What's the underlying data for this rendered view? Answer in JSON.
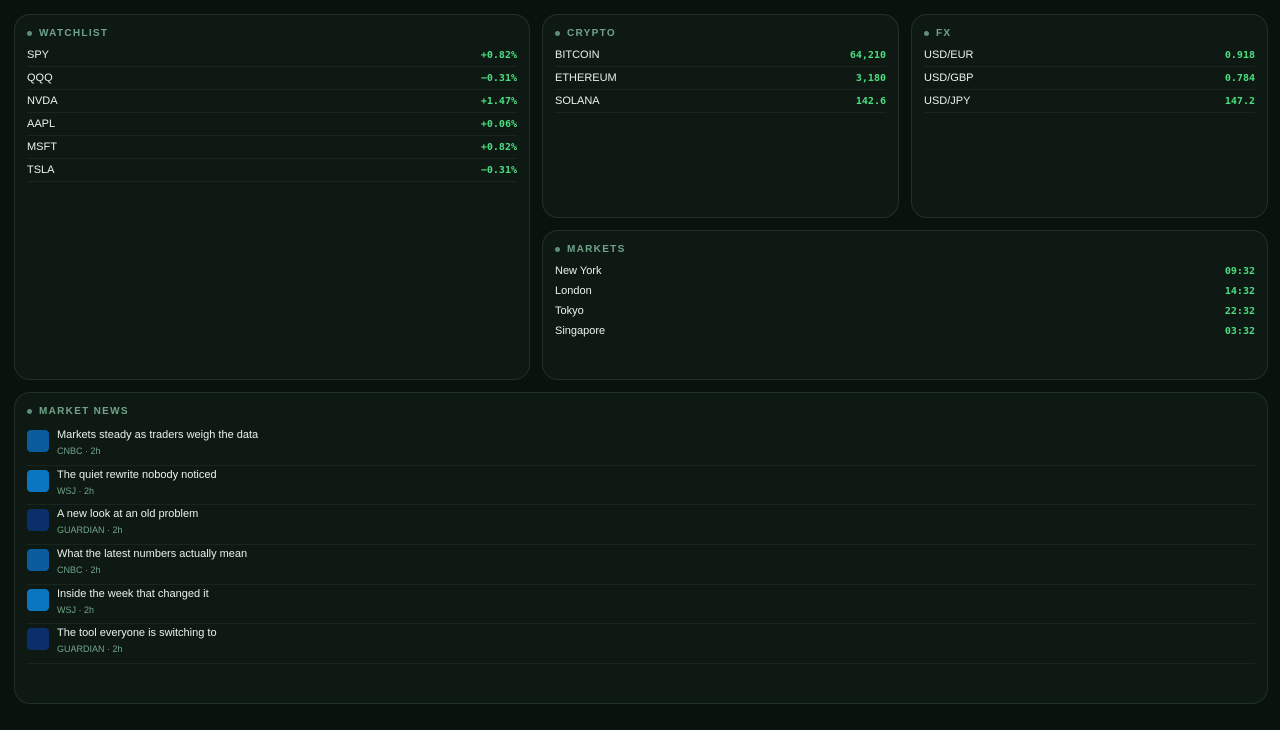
{
  "watchlist": {
    "title": "WATCHLIST",
    "items": [
      {
        "symbol": "SPY",
        "change": "+0.82%"
      },
      {
        "symbol": "QQQ",
        "change": "−0.31%"
      },
      {
        "symbol": "NVDA",
        "change": "+1.47%"
      },
      {
        "symbol": "AAPL",
        "change": "+0.06%"
      },
      {
        "symbol": "MSFT",
        "change": "+0.82%"
      },
      {
        "symbol": "TSLA",
        "change": "−0.31%"
      }
    ]
  },
  "crypto": {
    "title": "CRYPTO",
    "items": [
      {
        "name": "BITCOIN",
        "price": "64,210"
      },
      {
        "name": "ETHEREUM",
        "price": "3,180"
      },
      {
        "name": "SOLANA",
        "price": "142.6"
      }
    ]
  },
  "fx": {
    "title": "FX",
    "items": [
      {
        "pair": "USD/EUR",
        "rate": "0.918"
      },
      {
        "pair": "USD/GBP",
        "rate": "0.784"
      },
      {
        "pair": "USD/JPY",
        "rate": "147.2"
      }
    ]
  },
  "markets": {
    "title": "MARKETS",
    "items": [
      {
        "city": "New York",
        "time": "09:32"
      },
      {
        "city": "London",
        "time": "14:32"
      },
      {
        "city": "Tokyo",
        "time": "22:32"
      },
      {
        "city": "Singapore",
        "time": "03:32"
      }
    ]
  },
  "news": {
    "title": "MARKET NEWS",
    "items": [
      {
        "headline": "Markets steady as traders weigh the data",
        "meta": "CNBC · 2h",
        "thumb_color": "#0a5c9e"
      },
      {
        "headline": "The quiet rewrite nobody noticed",
        "meta": "WSJ · 2h",
        "thumb_color": "#0b76c0"
      },
      {
        "headline": "A new look at an old problem",
        "meta": "GUARDIAN · 2h",
        "thumb_color": "#0b2f6b"
      },
      {
        "headline": "What the latest numbers actually mean",
        "meta": "CNBC · 2h",
        "thumb_color": "#0a5c9e"
      },
      {
        "headline": "Inside the week that changed it",
        "meta": "WSJ · 2h",
        "thumb_color": "#0b76c0"
      },
      {
        "headline": "The tool everyone is switching to",
        "meta": "GUARDIAN · 2h",
        "thumb_color": "#0b2f6b"
      }
    ]
  },
  "colors": {
    "background": "#0a120e",
    "panel": "#0f1914",
    "accent_green": "#4ade80",
    "title_green": "#6fa387"
  }
}
